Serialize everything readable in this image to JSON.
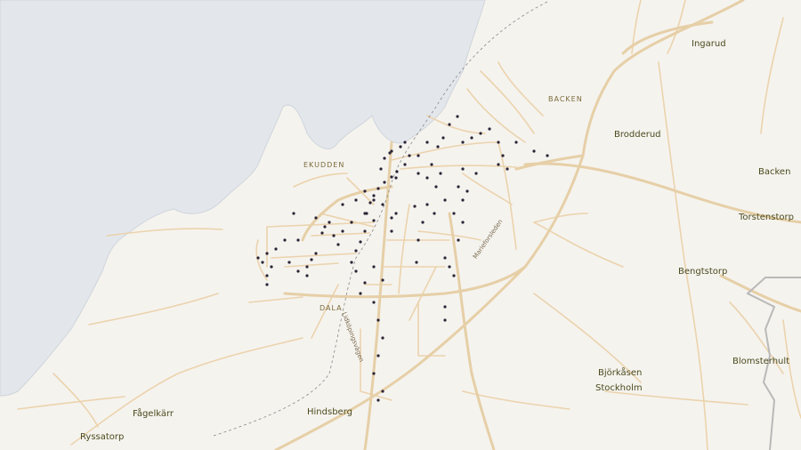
{
  "colors": {
    "land": "#f5f3ee",
    "water": "#e3e7ec",
    "coast": "#cfd5dc",
    "road": "#ebd3ad",
    "major_road": "#e6cfa7",
    "poi": "#2b2437",
    "boundary": "#b9b9b9",
    "rail": "#888888"
  },
  "labels": {
    "ingarud": "Ingarud",
    "backen_district": "BACKEN",
    "brodderud": "Brodderud",
    "backen": "Backen",
    "torstenstorp": "Torstenstorp",
    "ekudden": "EKUDDEN",
    "bengtstorp": "Bengtstorp",
    "dala": "DALA",
    "bjorkasen": "Björkåsen",
    "stockholm": "Stockholm",
    "blomsterhult": "Blomsterhult",
    "fagelkarr": "Fågelkärr",
    "hindsberg": "Hindsberg",
    "ryssatorp": "Ryssatorp",
    "road_marieforsleden": "Marieforsleden",
    "road_lidkopingsvagen": "Lidköpingsvägen"
  }
}
